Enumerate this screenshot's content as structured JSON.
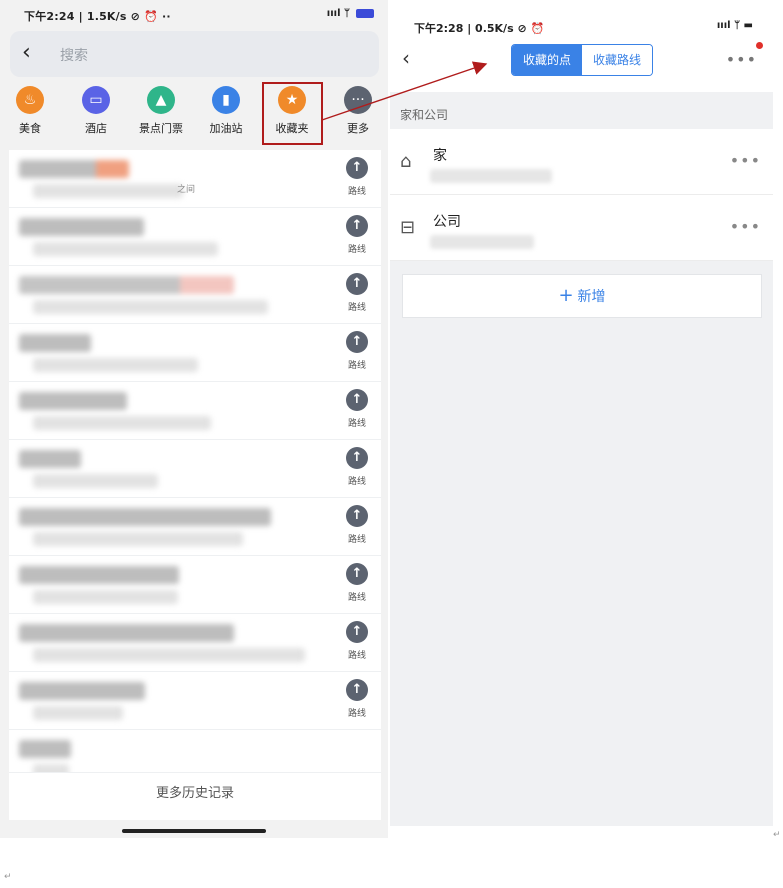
{
  "left": {
    "status": {
      "text": "下午2:24 | 1.5K/s ⊘ ⏰ ··",
      "icons": "ıııl ᛘ"
    },
    "search": {
      "placeholder": "搜索",
      "back_icon": "chevron-left-icon"
    },
    "categories": [
      {
        "label": "美食",
        "icon": "food-icon",
        "glyph": "♨",
        "color": "#f08a2a"
      },
      {
        "label": "酒店",
        "icon": "hotel-icon",
        "glyph": "▭",
        "color": "#5a63e6"
      },
      {
        "label": "景点门票",
        "icon": "scenic-icon",
        "glyph": "▲",
        "color": "#2fb58a"
      },
      {
        "label": "加油站",
        "icon": "gas-station-icon",
        "glyph": "▮",
        "color": "#3a82e6"
      },
      {
        "label": "收藏夹",
        "icon": "star-icon",
        "glyph": "★",
        "color": "#f08a2a"
      },
      {
        "label": "更多",
        "icon": "more-icon",
        "glyph": "···",
        "color": "#5c6370"
      }
    ],
    "history_rows": [
      {
        "route_label": "路线",
        "partial_text": "之间"
      },
      {
        "route_label": "路线"
      },
      {
        "route_label": "路线"
      },
      {
        "route_label": "路线"
      },
      {
        "route_label": "路线"
      },
      {
        "route_label": "路线"
      },
      {
        "route_label": "路线"
      },
      {
        "route_label": "路线"
      },
      {
        "route_label": "路线"
      },
      {
        "route_label": "路线"
      }
    ],
    "more_history": "更多历史记录"
  },
  "right": {
    "status": {
      "text": "下午2:28 | 0.5K/s ⊘ ⏰",
      "icons": "ıııl ᛘ ▬"
    },
    "tabs": [
      {
        "label": "收藏的点",
        "active": true
      },
      {
        "label": "收藏路线",
        "active": false
      }
    ],
    "section_label": "家和公司",
    "favorites": [
      {
        "name": "家",
        "icon": "home-icon",
        "glyph": "⌂"
      },
      {
        "name": "公司",
        "icon": "briefcase-icon",
        "glyph": "⊟"
      }
    ],
    "more_glyph": "•••",
    "add_button": {
      "plus": "+",
      "label": "新增"
    }
  },
  "accent_color": "#3a82e6",
  "highlight_color": "#b01c1c",
  "paragraph_mark": "↵"
}
